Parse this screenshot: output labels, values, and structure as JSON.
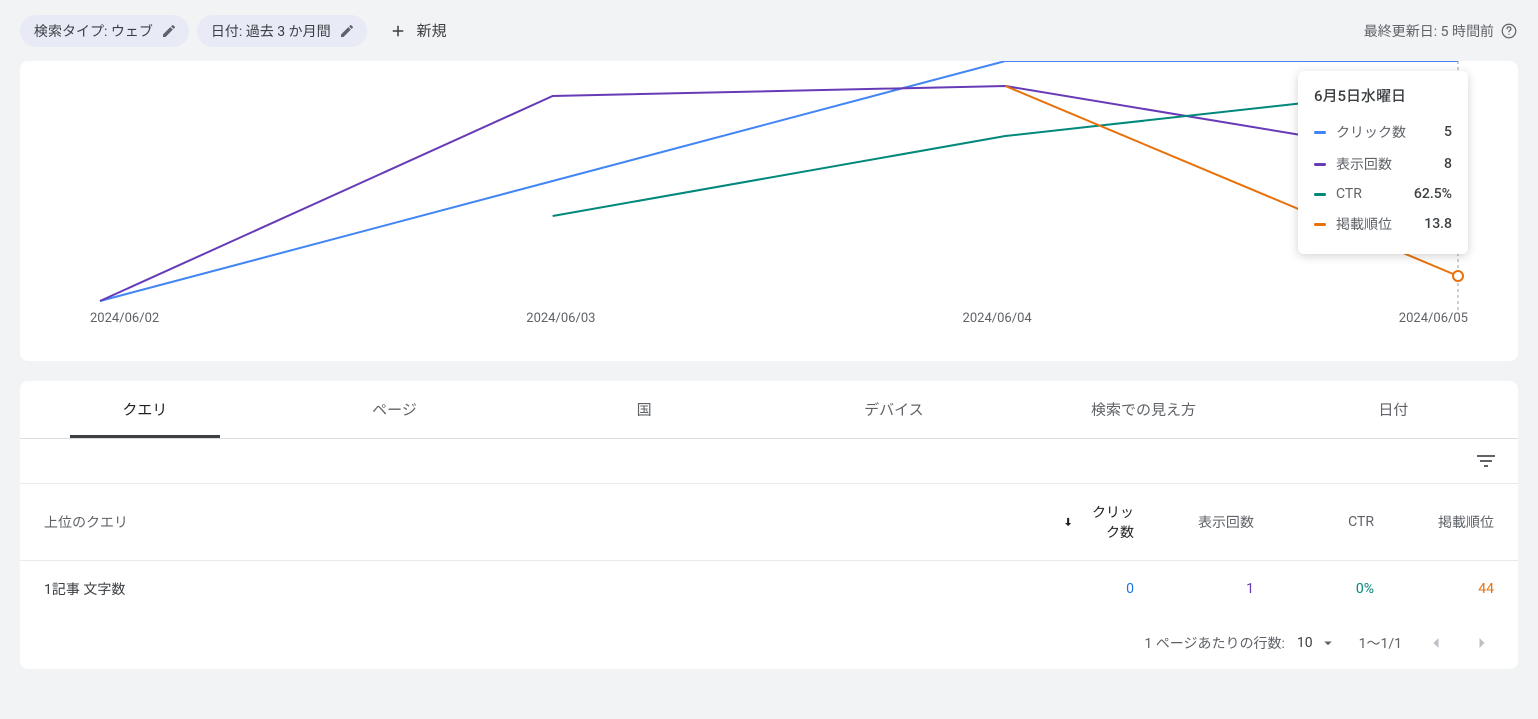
{
  "filters": {
    "search_type": "検索タイプ: ウェブ",
    "date": "日付: 過去 3 か月間",
    "new": "新規"
  },
  "last_update": "最終更新日: 5 時間前",
  "chart_data": {
    "type": "line",
    "x": [
      "2024/06/02",
      "2024/06/03",
      "2024/06/04",
      "2024/06/05"
    ],
    "series": [
      {
        "name": "クリック数",
        "color": "#4285f4",
        "values": [
          0,
          2,
          4,
          5
        ]
      },
      {
        "name": "表示回数",
        "color": "#673ab7",
        "values": [
          0,
          7,
          7,
          8
        ]
      },
      {
        "name": "CTR",
        "color": "#00897b",
        "values": [
          null,
          28.5,
          57.1,
          62.5
        ]
      },
      {
        "name": "掲載順位",
        "color": "#e8710a",
        "values": [
          null,
          null,
          7.4,
          13.8
        ]
      }
    ]
  },
  "tooltip": {
    "title": "6月5日水曜日",
    "rows": [
      {
        "label": "クリック数",
        "value": "5",
        "color": "#4285f4"
      },
      {
        "label": "表示回数",
        "value": "8",
        "color": "#673ab7"
      },
      {
        "label": "CTR",
        "value": "62.5%",
        "color": "#00897b"
      },
      {
        "label": "掲載順位",
        "value": "13.8",
        "color": "#e8710a"
      }
    ]
  },
  "tabs": [
    "クエリ",
    "ページ",
    "国",
    "デバイス",
    "検索での見え方",
    "日付"
  ],
  "active_tab": 0,
  "table": {
    "headers": {
      "query": "上位のクエリ",
      "clicks": "クリック数",
      "impressions": "表示回数",
      "ctr": "CTR",
      "position": "掲載順位"
    },
    "row": {
      "query": "1記事 文字数",
      "clicks": "0",
      "impressions": "1",
      "ctr": "0%",
      "position": "44"
    }
  },
  "pagination": {
    "rows_label": "1 ページあたりの行数:",
    "rows_value": "10",
    "range": "1～1/1"
  }
}
